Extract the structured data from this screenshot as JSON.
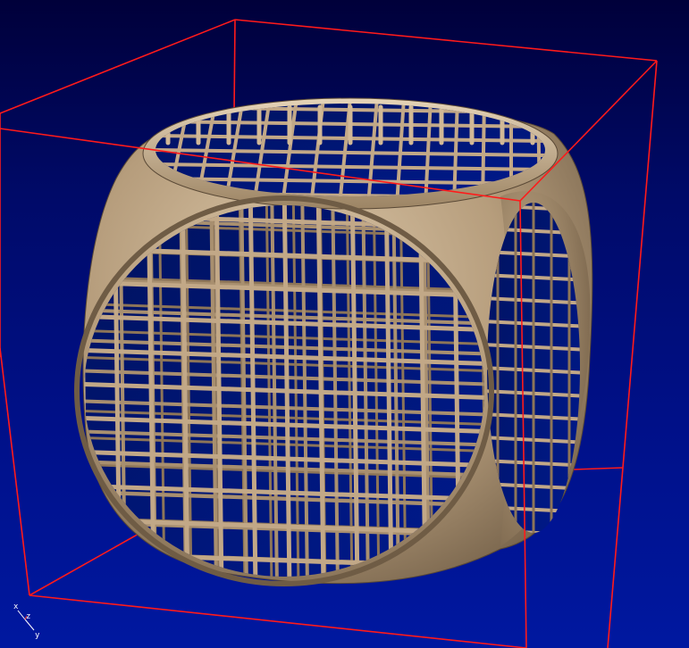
{
  "viewport": {
    "background_top": "#00003a",
    "background_bottom": "#0018a0",
    "bounding_box_color": "#ff1a1a",
    "model_color": "#b69d7c",
    "model_shadow_color": "#6f5c45",
    "model_highlight_color": "#e2cfb3"
  },
  "model": {
    "name": "cube-sphere-lattice-model"
  },
  "axes": {
    "x_label": "x",
    "y_label": "y",
    "z_label": "z",
    "x_color": "#ffffff",
    "y_color": "#ffffff",
    "z_color": "#ff3a3a"
  }
}
